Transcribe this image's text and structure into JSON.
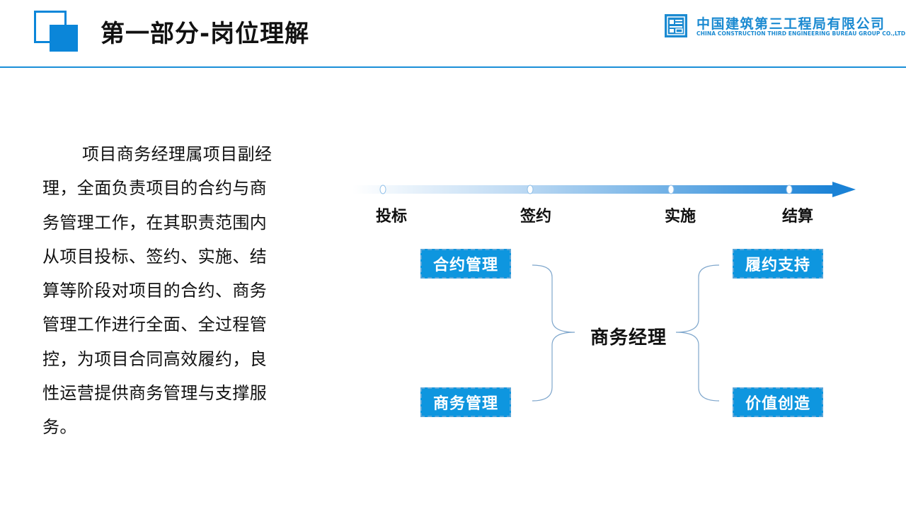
{
  "header": {
    "title": "第一部分-岗位理解",
    "logo_cn": "中国建筑第三工程局有限公司",
    "logo_en": "CHINA CONSTRUCTION THIRD ENGINEERING BUREAU GROUP CO.,LTD"
  },
  "description": "项目商务经理属项目副经理，全面负责项目的合约与商务管理工作，在其职责范围内从项目投标、签约、实施、结算等阶段对项目的合约、商务管理工作进行全面、全过程管控，为项目合同高效履约，良性运营提供商务管理与支撑服务。",
  "timeline": {
    "stages": [
      "投标",
      "签约",
      "实施",
      "结算"
    ]
  },
  "diagram": {
    "center": "商务经理",
    "left_boxes": [
      "合约管理",
      "商务管理"
    ],
    "right_boxes": [
      "履约支持",
      "价值创造"
    ]
  },
  "colors": {
    "accent": "#0b86d9",
    "box_fill": "#0e96df",
    "text": "#111111"
  }
}
